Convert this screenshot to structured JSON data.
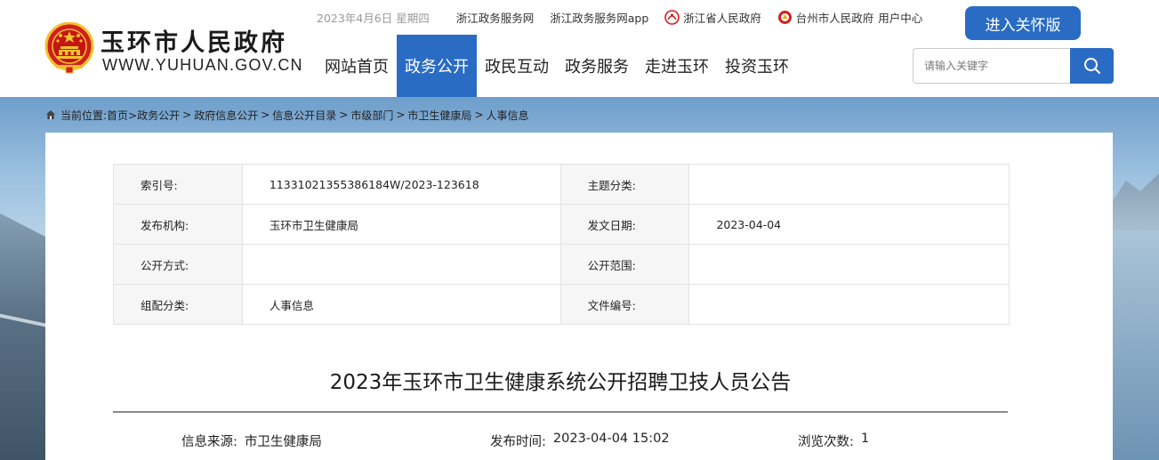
{
  "header": {
    "title": "玉环市人民政府",
    "domain": "WWW.YUHUAN.GOV.CN",
    "date": "2023年4月6日 星期四",
    "top_links": {
      "zj_service": "浙江政务服务网",
      "zj_service_app": "浙江政务服务网app",
      "zj_gov": "浙江省人民政府",
      "tz_gov": "台州市人民政府",
      "user_center": "用户中心"
    },
    "care_button": "进入关怀版",
    "nav": [
      "网站首页",
      "政务公开",
      "政民互动",
      "政务服务",
      "走进玉环",
      "投资玉环"
    ],
    "search_placeholder": "请输入关键字"
  },
  "breadcrumb": {
    "prefix": "当前位置:",
    "items": [
      "首页>",
      "政务公开",
      "政府信息公开",
      "信息公开目录",
      "市级部门",
      "市卫生健康局",
      "人事信息"
    ],
    "separator": ">"
  },
  "meta": {
    "rows": [
      {
        "k1": "索引号:",
        "v1": "11331021355386184W/2023-123618",
        "k2": "主题分类:",
        "v2": ""
      },
      {
        "k1": "发布机构:",
        "v1": "玉环市卫生健康局",
        "k2": "发文日期:",
        "v2": "2023-04-04"
      },
      {
        "k1": "公开方式:",
        "v1": "",
        "k2": "公开范围:",
        "v2": ""
      },
      {
        "k1": "组配分类:",
        "v1": "人事信息",
        "k2": "文件编号:",
        "v2": ""
      }
    ]
  },
  "article": {
    "title": "2023年玉环市卫生健康系统公开招聘卫技人员公告",
    "source_label": "信息来源:",
    "source": "市卫生健康局",
    "time_label": "发布时间:",
    "time": "2023-04-04 15:02",
    "views_label": "浏览次数:",
    "views": "1"
  },
  "colors": {
    "brand_blue": "#2a6cc4",
    "emblem_red": "#d11f1f",
    "emblem_gold": "#f4c22c"
  }
}
